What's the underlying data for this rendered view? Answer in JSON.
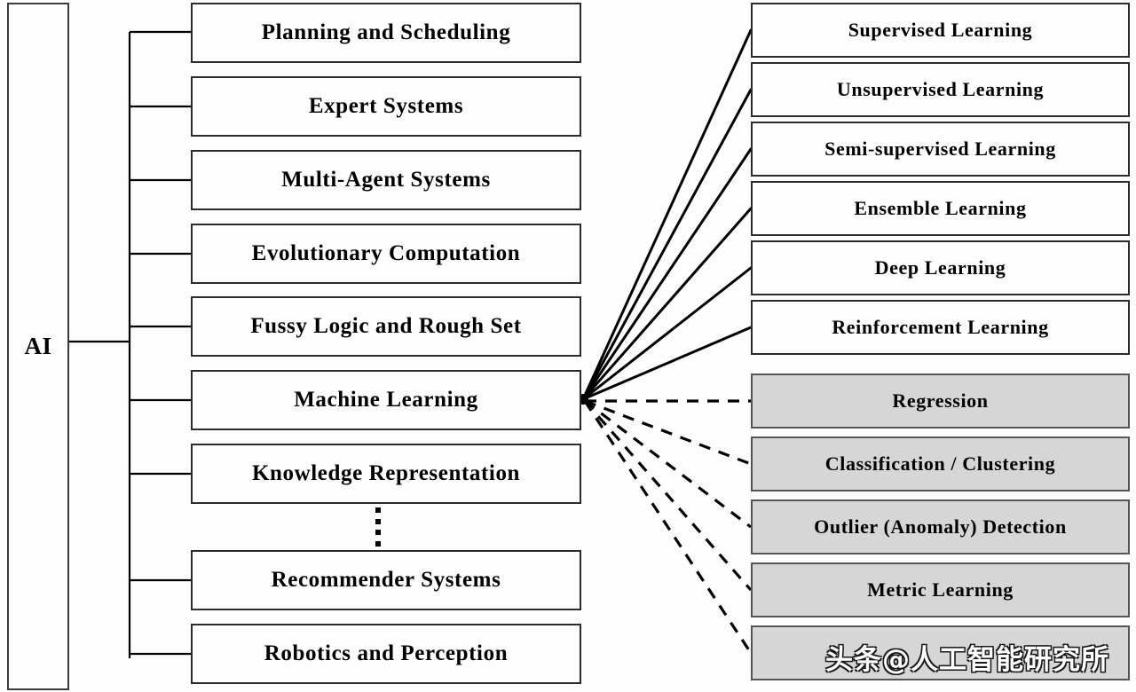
{
  "diagram": {
    "title": "AI taxonomy tree",
    "root": {
      "label": "AI"
    },
    "colors": {
      "box_stroke": "#2b2b2b",
      "gray_fill": "#d6d6d6",
      "gray_stroke": "#555555",
      "line": "#000000",
      "background": "#fdfdfd"
    },
    "branches": [
      {
        "label": "Planning and Scheduling"
      },
      {
        "label": "Expert Systems"
      },
      {
        "label": "Multi-Agent Systems"
      },
      {
        "label": "Evolutionary Computation"
      },
      {
        "label": "Fussy Logic and Rough Set"
      },
      {
        "label": "Machine Learning"
      },
      {
        "label": "Knowledge Representation"
      },
      {
        "label": "Recommender Systems"
      },
      {
        "label": "Robotics and Perception"
      }
    ],
    "ellipsis": "⋮",
    "ml_paradigms": [
      {
        "label": "Supervised Learning",
        "style": "white",
        "line": "solid"
      },
      {
        "label": "Unsupervised Learning",
        "style": "white",
        "line": "solid"
      },
      {
        "label": "Semi-supervised Learning",
        "style": "white",
        "line": "solid"
      },
      {
        "label": "Ensemble Learning",
        "style": "white",
        "line": "solid"
      },
      {
        "label": "Deep Learning",
        "style": "white",
        "line": "solid"
      },
      {
        "label": "Reinforcement Learning",
        "style": "white",
        "line": "solid"
      }
    ],
    "ml_tasks": [
      {
        "label": "Regression",
        "style": "gray",
        "line": "dashed"
      },
      {
        "label": "Classification / Clustering",
        "style": "gray",
        "line": "dashed"
      },
      {
        "label": "Outlier (Anomaly) Detection",
        "style": "gray",
        "line": "dashed"
      },
      {
        "label": "Metric Learning",
        "style": "gray",
        "line": "dashed"
      },
      {
        "label": "",
        "style": "gray",
        "line": "dashed"
      }
    ],
    "watermark": {
      "text": "头条@人工智能研究所"
    }
  }
}
